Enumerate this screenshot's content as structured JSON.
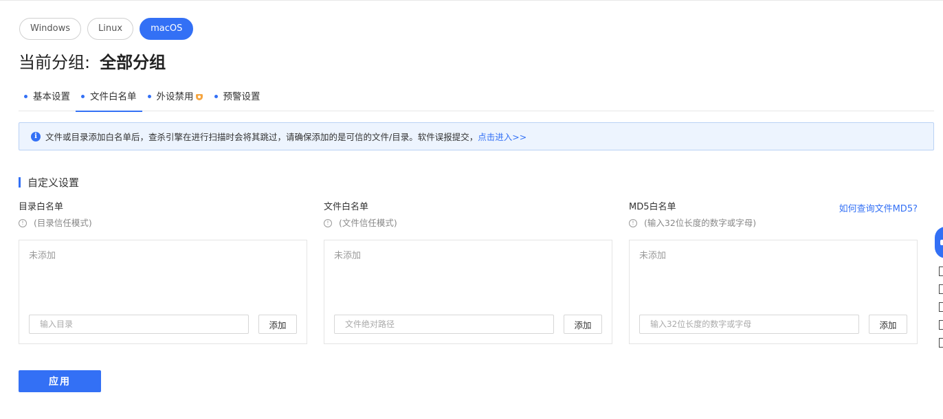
{
  "os_tabs": [
    {
      "label": "Windows",
      "active": false
    },
    {
      "label": "Linux",
      "active": false
    },
    {
      "label": "macOS",
      "active": true
    }
  ],
  "group": {
    "label": "当前分组:",
    "value": "全部分组"
  },
  "sub_tabs": [
    {
      "label": "基本设置",
      "active": false
    },
    {
      "label": "文件白名单",
      "active": true
    },
    {
      "label": "外设禁用",
      "active": false,
      "badge": "vip-icon"
    },
    {
      "label": "预警设置",
      "active": false
    }
  ],
  "info": {
    "text": "文件或目录添加白名单后，查杀引擎在进行扫描时会将其跳过，请确保添加的是可信的文件/目录。软件误报提交，",
    "link": "点击进入>>"
  },
  "section_title": "自定义设置",
  "columns": [
    {
      "title": "目录白名单",
      "hint": "(目录信任模式)",
      "empty": "未添加",
      "placeholder": "输入目录",
      "button": "添加"
    },
    {
      "title": "文件白名单",
      "hint": "(文件信任模式)",
      "empty": "未添加",
      "placeholder": "文件绝对路径",
      "button": "添加"
    },
    {
      "title": "MD5白名单",
      "hint": "(输入32位长度的数字或字母)",
      "empty": "未添加",
      "placeholder": "输入32位长度的数字或字母",
      "button": "添加",
      "link": "如何查询文件MD5?"
    }
  ],
  "apply_label": "应用",
  "colors": {
    "accent": "#3370f5",
    "info_bg": "#edf4fe"
  }
}
